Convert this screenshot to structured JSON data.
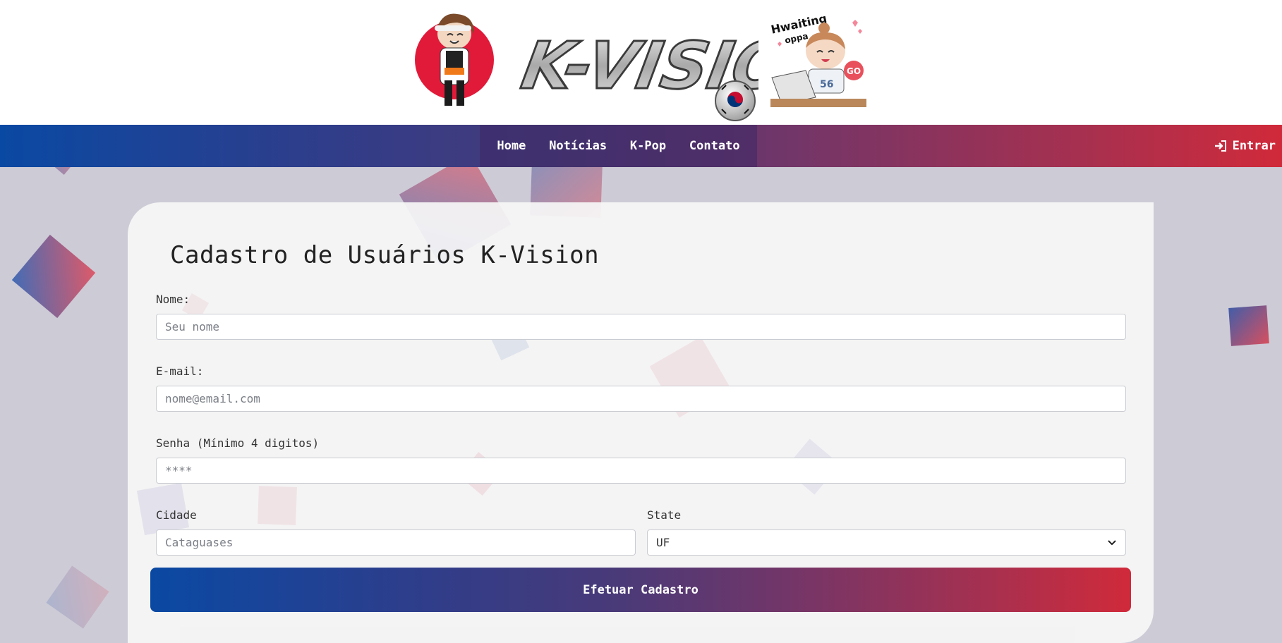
{
  "brand": {
    "logo_text": "K-VISION",
    "sticker_text_top": "Hwaiting",
    "sticker_text_sub": "oppa",
    "sticker_badge": "GO",
    "sticker_jersey": "56"
  },
  "nav": {
    "links": [
      "Home",
      "Notícias",
      "K-Pop",
      "Contato"
    ],
    "login_label": "Entrar",
    "login_icon": "sign-in-icon"
  },
  "form": {
    "title": "Cadastro de Usuários K-Vision",
    "name": {
      "label": "Nome:",
      "placeholder": "Seu nome"
    },
    "email": {
      "label": "E-mail:",
      "placeholder": "nome@email.com"
    },
    "password": {
      "label": "Senha (Mínimo 4 digitos)",
      "placeholder": "****"
    },
    "city": {
      "label": "Cidade",
      "placeholder": "Cataguases"
    },
    "state": {
      "label": "State",
      "selected": "UF"
    },
    "submit_label": "Efetuar Cadastro"
  },
  "colors": {
    "gradient_start": "#0a49a3",
    "gradient_mid": "#4a3a78",
    "gradient_end": "#d02a3a",
    "page_bg": "#cdcbd6",
    "card_bg": "#f6f6f6"
  }
}
